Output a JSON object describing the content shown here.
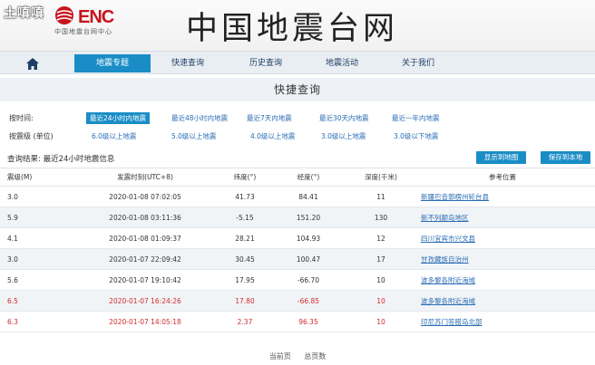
{
  "watermark": "土嗔嗔",
  "header": {
    "logo_text": "ENC",
    "logo_sub": "中国地震台网中心",
    "site_title": "中国地震台网"
  },
  "nav": {
    "items": [
      {
        "label": "地震专题"
      },
      {
        "label": "快速查询"
      },
      {
        "label": "历史查询"
      },
      {
        "label": "地震活动"
      },
      {
        "label": "关于我们"
      }
    ]
  },
  "section_title": "快捷查询",
  "filters": {
    "time_label": "按时间:",
    "time_options": [
      "最近24小时内地震",
      "最近48小时内地震",
      "最近7天内地震",
      "最近30天内地震",
      "最近一年内地震"
    ],
    "mag_label": "按震级 (单位)",
    "mag_options": [
      "6.0级以上地震",
      "5.0级以上地震",
      "4.0级以上地震",
      "3.0级以上地震",
      "3.0级以下地震"
    ]
  },
  "result": {
    "text": "查询结果: 最近24小时地震信息",
    "btn_map": "显示到地图",
    "btn_save": "保存到本地"
  },
  "table": {
    "headers": [
      "震级(M)",
      "发震时刻(UTC+8)",
      "纬度(°)",
      "经度(°)",
      "深度(千米)",
      "参考位置"
    ],
    "rows": [
      {
        "mag": "3.0",
        "time": "2020-01-08 07:02:05",
        "lat": "41.73",
        "lon": "84.41",
        "depth": "11",
        "loc": "新疆巴音郭楞州轮台县"
      },
      {
        "mag": "5.9",
        "time": "2020-01-08 03:11:36",
        "lat": "-5.15",
        "lon": "151.20",
        "depth": "130",
        "loc": "新不列颠岛地区"
      },
      {
        "mag": "4.1",
        "time": "2020-01-08 01:09:37",
        "lat": "28.21",
        "lon": "104.93",
        "depth": "12",
        "loc": "四川宜宾市兴文县"
      },
      {
        "mag": "3.0",
        "time": "2020-01-07 22:09:42",
        "lat": "30.45",
        "lon": "100.47",
        "depth": "17",
        "loc": "甘孜藏族自治州"
      },
      {
        "mag": "5.6",
        "time": "2020-01-07 19:10:42",
        "lat": "17.95",
        "lon": "-66.70",
        "depth": "10",
        "loc": "波多黎各附近海域"
      },
      {
        "mag": "6.5",
        "time": "2020-01-07 16:24:26",
        "lat": "17.80",
        "lon": "-66.85",
        "depth": "10",
        "loc": "波多黎各附近海域"
      },
      {
        "mag": "6.3",
        "time": "2020-01-07 14:05:18",
        "lat": "2.37",
        "lon": "96.35",
        "depth": "10",
        "loc": "印尼苏门答腊岛北部"
      }
    ]
  },
  "pager": {
    "first": "当前页",
    "total": "总页数"
  },
  "colors": {
    "accent": "#1a8dc6",
    "brand_red": "#c7141c",
    "highlight_red": "#d22b2b"
  }
}
